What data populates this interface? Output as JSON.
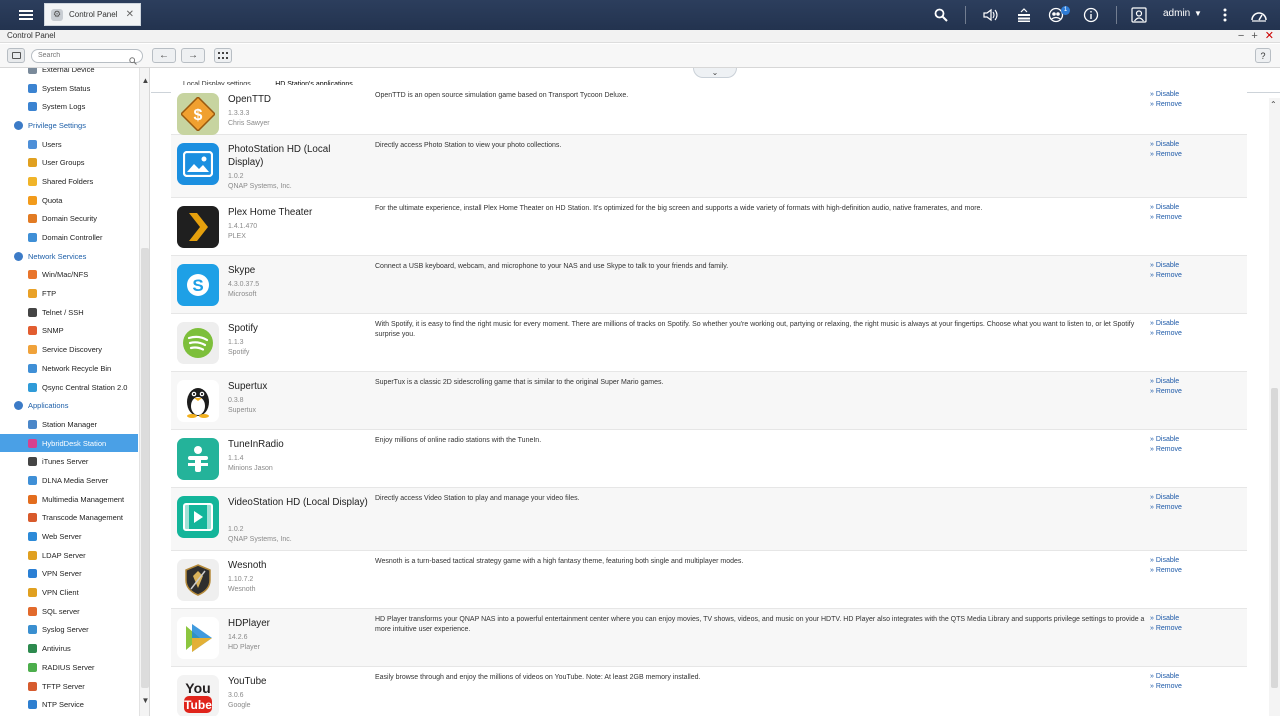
{
  "topbar": {
    "tab_label": "Control Panel",
    "user": "admin",
    "notification_count": "1"
  },
  "window": {
    "title": "Control Panel"
  },
  "toolbar": {
    "search_placeholder": "Search",
    "help": "?"
  },
  "sidebar": {
    "items": [
      {
        "label": "External Device",
        "type": "item",
        "color": "#7a8a9a"
      },
      {
        "label": "System Status",
        "type": "item",
        "color": "#3b83d1"
      },
      {
        "label": "System Logs",
        "type": "item",
        "color": "#3b83d1"
      },
      {
        "label": "Privilege Settings",
        "type": "cat",
        "color": "#3c7bc7"
      },
      {
        "label": "Users",
        "type": "item",
        "color": "#4d8fd8"
      },
      {
        "label": "User Groups",
        "type": "item",
        "color": "#e0a020"
      },
      {
        "label": "Shared Folders",
        "type": "item",
        "color": "#f0b429"
      },
      {
        "label": "Quota",
        "type": "item",
        "color": "#f29b1b"
      },
      {
        "label": "Domain Security",
        "type": "item",
        "color": "#e27b23"
      },
      {
        "label": "Domain Controller",
        "type": "item",
        "color": "#3f8fd6"
      },
      {
        "label": "Network Services",
        "type": "cat",
        "color": "#3c7bc7"
      },
      {
        "label": "Win/Mac/NFS",
        "type": "item",
        "color": "#e8742b"
      },
      {
        "label": "FTP",
        "type": "item",
        "color": "#e9a127"
      },
      {
        "label": "Telnet / SSH",
        "type": "item",
        "color": "#444444"
      },
      {
        "label": "SNMP",
        "type": "item",
        "color": "#e25d30"
      },
      {
        "label": "Service Discovery",
        "type": "item",
        "color": "#f0a23a"
      },
      {
        "label": "Network Recycle Bin",
        "type": "item",
        "color": "#3f8fd6"
      },
      {
        "label": "Qsync Central Station 2.0",
        "type": "item",
        "color": "#2f9bd8"
      },
      {
        "label": "Applications",
        "type": "cat",
        "color": "#3c7bc7"
      },
      {
        "label": "Station Manager",
        "type": "item",
        "color": "#4b87c9"
      },
      {
        "label": "HybridDesk Station",
        "type": "item",
        "active": true,
        "color": "#d8418e"
      },
      {
        "label": "iTunes Server",
        "type": "item",
        "color": "#444444"
      },
      {
        "label": "DLNA Media Server",
        "type": "item",
        "color": "#3f8fd6"
      },
      {
        "label": "Multimedia Management",
        "type": "item",
        "color": "#e36d1e"
      },
      {
        "label": "Transcode Management",
        "type": "item",
        "color": "#d85a2b"
      },
      {
        "label": "Web Server",
        "type": "item",
        "color": "#2c8ad8"
      },
      {
        "label": "LDAP Server",
        "type": "item",
        "color": "#e0a020"
      },
      {
        "label": "VPN Server",
        "type": "item",
        "color": "#2a7fd4"
      },
      {
        "label": "VPN Client",
        "type": "item",
        "color": "#e0a020"
      },
      {
        "label": "SQL server",
        "type": "item",
        "color": "#e26a2c"
      },
      {
        "label": "Syslog Server",
        "type": "item",
        "color": "#3a8fd0"
      },
      {
        "label": "Antivirus",
        "type": "item",
        "color": "#2d8a4e"
      },
      {
        "label": "RADIUS Server",
        "type": "item",
        "color": "#4cae4c"
      },
      {
        "label": "TFTP Server",
        "type": "item",
        "color": "#d65b2e"
      },
      {
        "label": "NTP Service",
        "type": "item",
        "color": "#2e7fd0"
      }
    ]
  },
  "main": {
    "tabs": [
      {
        "label": "Local Display settings"
      },
      {
        "label": "HD Station's applications"
      }
    ],
    "disable_label": "» Disable",
    "remove_label": "» Remove",
    "apps": [
      {
        "name": "OpenTTD",
        "version": "1.3.3.3",
        "publisher": "Chris Sawyer",
        "description": "OpenTTD is an open source simulation game based on Transport Tycoon Deluxe.",
        "icon": "openttd-icon",
        "icon_color": "#c7d4a0"
      },
      {
        "name": "PhotoStation HD (Local Display)",
        "version": "1.0.2",
        "publisher": "QNAP Systems, Inc.",
        "description": "Directly access Photo Station to view your photo collections.",
        "icon": "photostation-icon",
        "icon_color": "#1b8fe0"
      },
      {
        "name": "Plex Home Theater",
        "version": "1.4.1.470",
        "publisher": "PLEX",
        "description": "For the ultimate experience, install Plex Home Theater on HD Station. It's optimized for the big screen and supports a wide variety of formats with high-definition audio, native framerates, and more.",
        "icon": "plex-icon",
        "icon_color": "#1f1f1f"
      },
      {
        "name": "Skype",
        "version": "4.3.0.37.5",
        "publisher": "Microsoft",
        "description": "Connect a USB keyboard, webcam, and microphone to your NAS and use Skype to talk to your friends and family.",
        "icon": "skype-icon",
        "icon_color": "#1ea0e6"
      },
      {
        "name": "Spotify",
        "version": "1.1.3",
        "publisher": "Spotify",
        "description": "With Spotify, it is easy to find the right music for every moment. There are millions of tracks on Spotify. So whether you're working out, partying or relaxing, the right music is always at your fingertips. Choose what you want to listen to, or let Spotify surprise you.",
        "icon": "spotify-icon",
        "icon_color": "#eeeeee"
      },
      {
        "name": "Supertux",
        "version": "0.3.8",
        "publisher": "Supertux",
        "description": "SuperTux is a classic 2D sidescrolling game that is similar to the original Super Mario games.",
        "icon": "supertux-icon",
        "icon_color": "#ffffff"
      },
      {
        "name": "TuneInRadio",
        "version": "1.1.4",
        "publisher": "Minions Jason",
        "description": "Enjoy millions of online radio stations with the TuneIn.",
        "icon": "tunein-icon",
        "icon_color": "#24b39a"
      },
      {
        "name": "VideoStation HD (Local Display)",
        "version": "1.0.2",
        "publisher": "QNAP Systems, Inc.",
        "description": "Directly access Video Station to play and manage your video files.",
        "icon": "videostation-icon",
        "icon_color": "#13b59a"
      },
      {
        "name": "Wesnoth",
        "version": "1.10.7.2",
        "publisher": "Wesnoth",
        "description": "Wesnoth is a turn-based tactical strategy game with a high fantasy theme, featuring both single and multiplayer modes.",
        "icon": "wesnoth-icon",
        "icon_color": "#efefef"
      },
      {
        "name": "HDPlayer",
        "version": "14.2.6",
        "publisher": "HD Player",
        "description": "HD Player transforms your QNAP NAS into a powerful entertainment center where you can enjoy movies, TV shows, videos, and music on your HDTV. HD Player also integrates with the QTS Media Library and supports privilege settings to provide a more intuitive user experience.",
        "icon": "hdplayer-icon",
        "icon_color": "#ffffff"
      },
      {
        "name": "YouTube",
        "version": "3.0.6",
        "publisher": "Google",
        "description": "Easily browse through and enjoy the millions of videos on YouTube. Note: At least 2GB memory installed.",
        "icon": "youtube-icon",
        "icon_color": "#f3f3f3"
      }
    ]
  }
}
